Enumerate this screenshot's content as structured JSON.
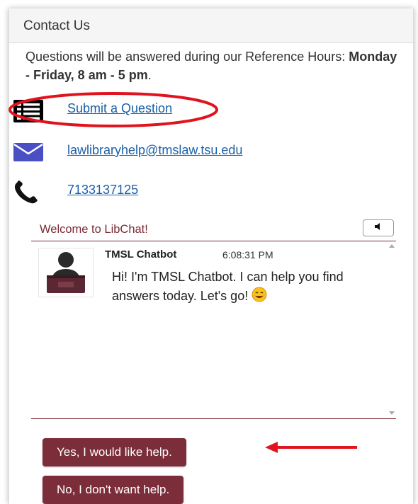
{
  "panel": {
    "title": "Contact Us"
  },
  "intro": {
    "text": "Questions will be answered during our Reference Hours: ",
    "hours": "Monday - Friday, 8 am - 5 pm",
    "end": "."
  },
  "contacts": [
    {
      "icon": "list-icon",
      "label": "Submit a Question"
    },
    {
      "icon": "envelope-icon",
      "label": "lawlibraryhelp@tmslaw.tsu.edu"
    },
    {
      "icon": "phone-icon",
      "label": "7133137125"
    }
  ],
  "libchat": {
    "title": "Welcome to LibChat!",
    "sound_icon": "speaker-icon",
    "message": {
      "sender": "TMSL Chatbot",
      "time": "6:08:31 PM",
      "text": "Hi! I'm TMSL Chatbot. I can help you find answers today. Let's go!",
      "emoji_icon": "smiley-icon"
    },
    "buttons": {
      "yes": "Yes, I would like help.",
      "no": "No, I don't want help."
    }
  },
  "colors": {
    "accent": "#7b2d3a",
    "link": "#1a5fa8",
    "annotation_red": "#e0141e"
  }
}
